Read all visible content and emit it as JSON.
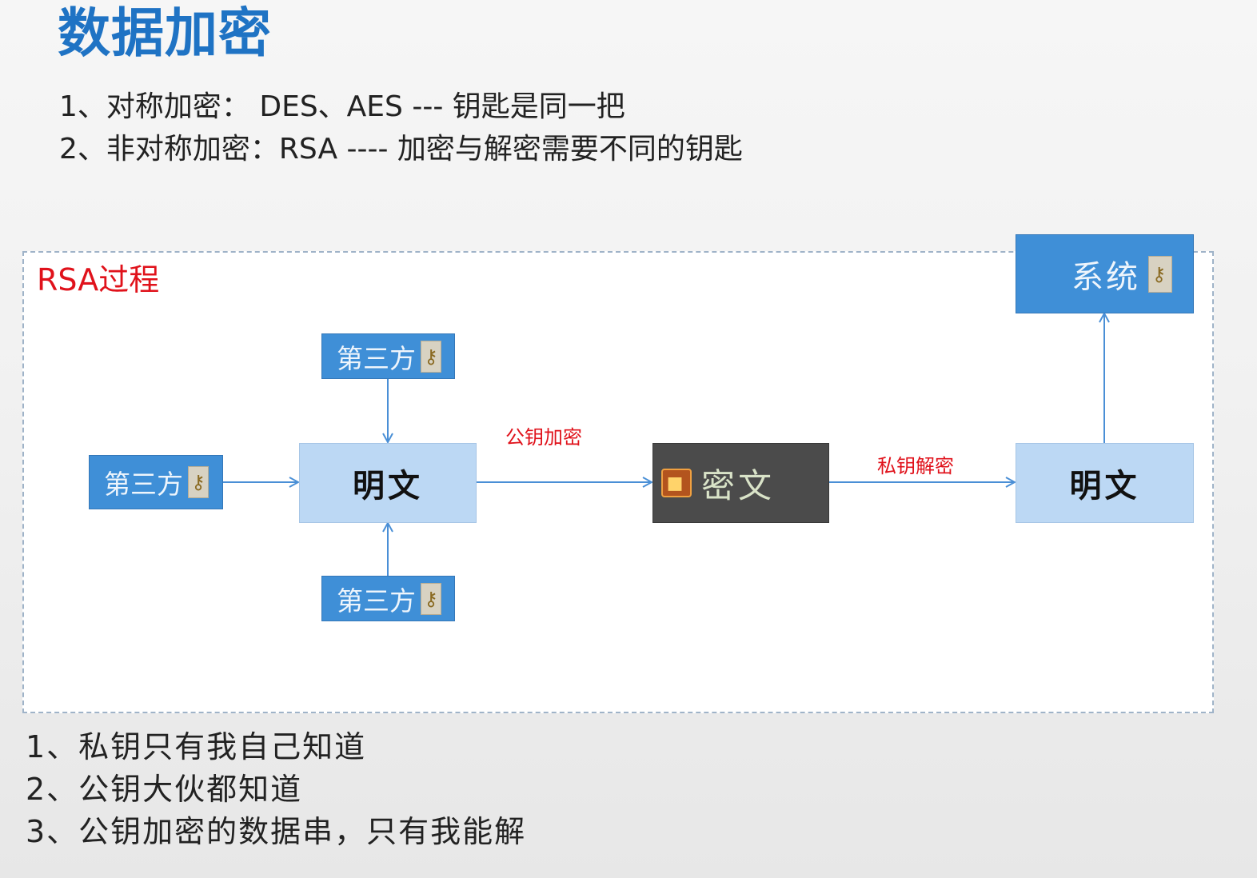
{
  "title": "数据加密",
  "types": [
    "1、对称加密： DES、AES --- 钥匙是同一把",
    "2、非对称加密：RSA ---- 加密与解密需要不同的钥匙"
  ],
  "diagram": {
    "title": "RSA过程",
    "third_party": "第三方",
    "plaintext": "明文",
    "ciphertext": "密文",
    "system": "系统",
    "public_key_encrypt": "公钥加密",
    "private_key_decrypt": "私钥解密",
    "key_icon": "key-icon",
    "lock_icon": "lock-icon",
    "colors": {
      "accent_blue": "#3f8fd7",
      "light_blue": "#bcd8f4",
      "dark_box": "#4b4b4b",
      "red_label": "#e0121b",
      "title_blue": "#1f73c4"
    }
  },
  "notes": [
    "1、私钥只有我自己知道",
    "2、公钥大伙都知道",
    "3、公钥加密的数据串，只有我能解"
  ]
}
